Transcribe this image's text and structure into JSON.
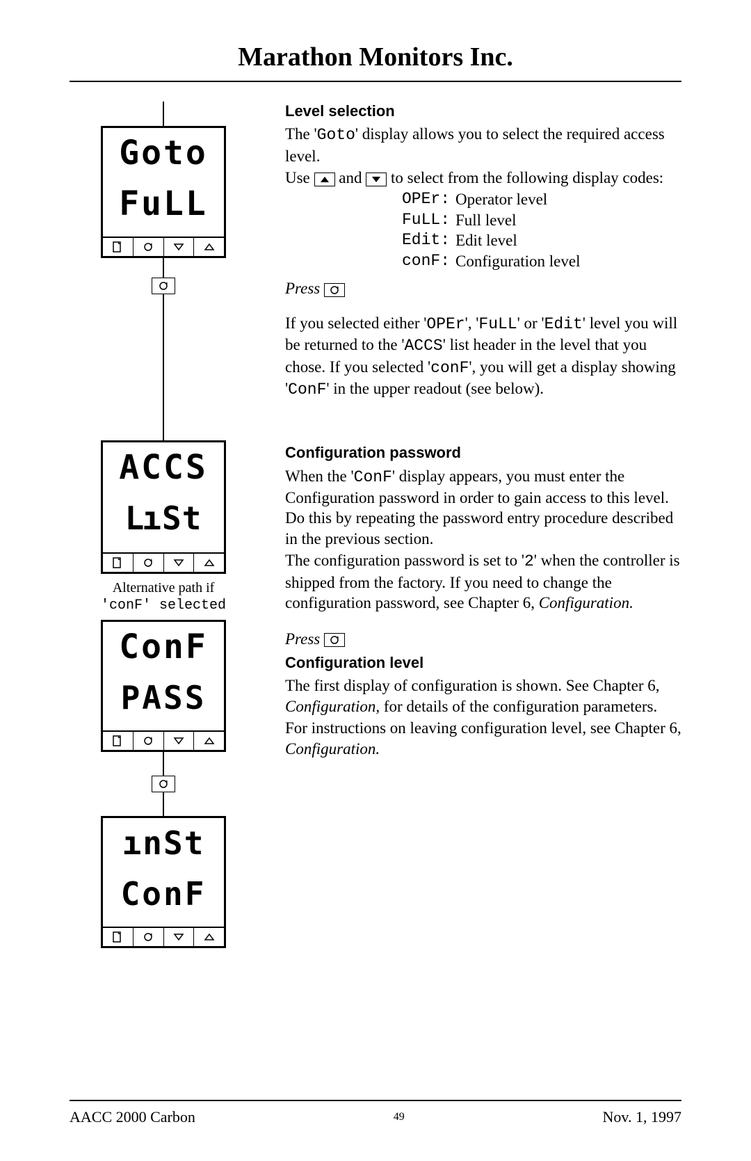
{
  "header": {
    "company": "Marathon Monitors Inc."
  },
  "devices": {
    "d1": {
      "upper": "Goto",
      "lower": "FuLL"
    },
    "d2": {
      "upper": "ACCS",
      "lower": "LiSt"
    },
    "d3": {
      "upper": "ConF",
      "lower": "PASS"
    },
    "d4": {
      "upper": "inSt",
      "lower": "ConF"
    }
  },
  "alt_caption_line1": "Alternative path if",
  "alt_caption_line2": "'conF' selected",
  "sections": {
    "level_sel": {
      "title": "Level selection",
      "p1a": "The '",
      "p1code": "Goto",
      "p1b": "' display allows you to select the required access level.",
      "p2a": "Use ",
      "p2b": " and ",
      "p2c": " to select from the following display codes:",
      "codes": [
        {
          "code": "OPEr:",
          "desc": "Operator level"
        },
        {
          "code": "FuLL:",
          "desc": "Full level"
        },
        {
          "code": "Edit:",
          "desc": "Edit level"
        },
        {
          "code": "conF:",
          "desc": "Configuration level"
        }
      ],
      "press": "Press ",
      "p3a": "If you selected either '",
      "p3c1": "OPEr",
      "p3b": "', '",
      "p3c2": "FuLL",
      "p3c": "' or '",
      "p3c3": "Edit",
      "p3d": "' level you will be returned to the '",
      "p3c4": "ACCS",
      "p3e": "' list header in the level that you chose.  If you selected '",
      "p3c5": "conF",
      "p3f": "', you will get a display showing '",
      "p3c6": "ConF",
      "p3g": "' in the upper readout (see below)."
    },
    "conf_pw": {
      "title": "Configuration password",
      "p1a": "When the '",
      "p1code": "ConF",
      "p1b": "' display appears, you must enter the Configuration password in order to gain access to this level.  Do this by repeating the password entry procedure described in the previous section.",
      "p2a": "The configuration password is set to '",
      "p2code": "2",
      "p2b": "' when the controller is shipped from the factory.  If you need to change the configuration password, see Chapter 6, ",
      "p2ital": "Configuration.",
      "press": "Press "
    },
    "conf_lvl": {
      "title": "Configuration level",
      "p1": "The first display of configuration is shown. See Chapter 6, ",
      "p1ital": "Configuration,",
      "p1b": " for details of the configuration parameters.",
      "p2": "For instructions on leaving configuration level, see Chapter 6, ",
      "p2ital": "Configuration."
    }
  },
  "footer": {
    "left": "AACC 2000 Carbon",
    "page": "49",
    "right": "Nov.  1, 1997"
  }
}
